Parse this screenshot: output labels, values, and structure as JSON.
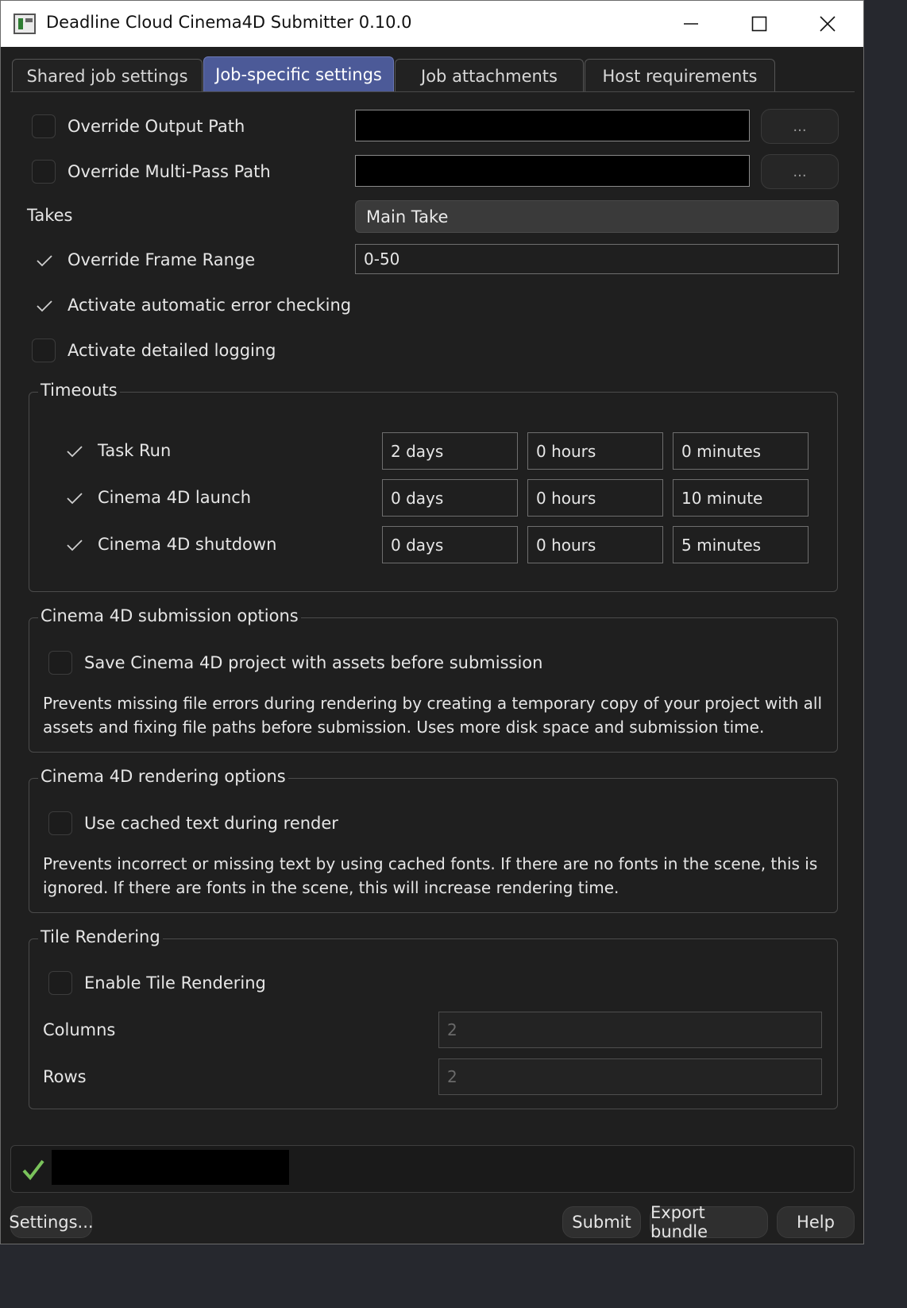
{
  "window": {
    "title": "Deadline Cloud Cinema4D Submitter 0.10.0",
    "icon": "app-window-icon"
  },
  "tabs": [
    {
      "label": "Shared job settings",
      "active": false
    },
    {
      "label": "Job-specific settings",
      "active": true
    },
    {
      "label": "Job attachments",
      "active": false
    },
    {
      "label": "Host requirements",
      "active": false
    }
  ],
  "form": {
    "override_output_path": {
      "label": "Override Output Path",
      "checked": false,
      "value": "",
      "browse": "..."
    },
    "override_multipass_path": {
      "label": "Override Multi-Pass Path",
      "checked": false,
      "value": "",
      "browse": "..."
    },
    "takes": {
      "label": "Takes",
      "value": "Main Take"
    },
    "override_frame_range": {
      "label": "Override Frame Range",
      "checked": true,
      "value": "0-50"
    },
    "auto_error_checking": {
      "label": "Activate automatic error checking",
      "checked": true
    },
    "detailed_logging": {
      "label": "Activate detailed logging",
      "checked": false
    }
  },
  "timeouts": {
    "title": "Timeouts",
    "rows": [
      {
        "label": "Task Run",
        "checked": true,
        "days": "2 days",
        "hours": "0 hours",
        "minutes": "0 minutes"
      },
      {
        "label": "Cinema 4D launch",
        "checked": true,
        "days": "0 days",
        "hours": "0 hours",
        "minutes": "10 minute"
      },
      {
        "label": "Cinema 4D shutdown",
        "checked": true,
        "days": "0 days",
        "hours": "0 hours",
        "minutes": "5 minutes"
      }
    ]
  },
  "submission_options": {
    "title": "Cinema 4D submission options",
    "save_with_assets": {
      "label": "Save Cinema 4D project with assets before submission",
      "checked": false
    },
    "description": "Prevents missing file errors during rendering by creating a temporary copy of your project with all assets and fixing file paths before submission. Uses more disk space and submission time."
  },
  "rendering_options": {
    "title": "Cinema 4D rendering options",
    "cached_text": {
      "label": "Use cached text during render",
      "checked": false
    },
    "description": "Prevents incorrect or missing text by using cached fonts. If there are no fonts in the scene, this is ignored. If there are fonts in the scene, this will increase rendering time."
  },
  "tile_rendering": {
    "title": "Tile Rendering",
    "enable": {
      "label": "Enable Tile Rendering",
      "checked": false
    },
    "columns": {
      "label": "Columns",
      "value": "2"
    },
    "rows": {
      "label": "Rows",
      "value": "2"
    }
  },
  "status": {
    "ok_icon": "green-check-icon",
    "text": ""
  },
  "buttons": {
    "settings": "Settings...",
    "submit": "Submit",
    "export": "Export bundle",
    "help": "Help"
  },
  "colors": {
    "accent_tab": "#4c5a98",
    "check_ok": "#7ac35b",
    "background": "#1f1f1f"
  }
}
